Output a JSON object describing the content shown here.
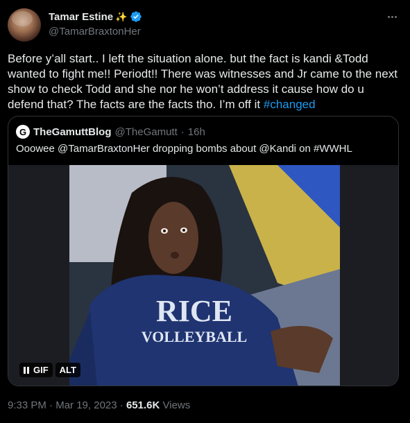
{
  "author": {
    "display_name": "Tamar Estine",
    "name_emoji": "✨",
    "handle": "@TamarBraxtonHer"
  },
  "tweet": {
    "text": "Before y’all start.. I left the situation alone. but the fact is kandi &Todd wanted to fight me!! Periodt!! There was witnesses and Jr came to the next show to check Todd and she nor he won’t address it cause how do u defend that? The facts are the facts tho. I’m off it ",
    "hashtag": "#changed"
  },
  "quote": {
    "name": "TheGamuttBlog",
    "handle": "@TheGamutt",
    "separator": "·",
    "time": "16h",
    "text": "Ooowee @TamarBraxtonHer dropping bombs about @Kandi on #WWHL",
    "avatar_letter": "G",
    "media": {
      "shirt_line1": "RICE",
      "shirt_line2": "VOLLEYBALL",
      "gif_label": "GIF",
      "alt_label": "ALT"
    }
  },
  "footer": {
    "time": "9:33 PM",
    "separator": "·",
    "date": "Mar 19, 2023",
    "views_count": "651.6K",
    "views_label": "Views"
  },
  "colors": {
    "background": "#000000",
    "text": "#e7e9ea",
    "secondary": "#71767b",
    "link": "#1d9bf0",
    "border": "#2f3336"
  }
}
